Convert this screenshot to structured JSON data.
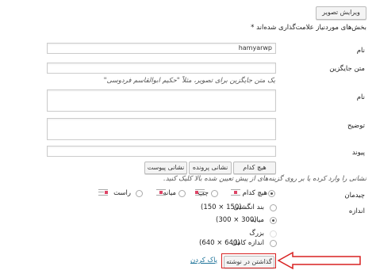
{
  "header": {
    "edit_image_button": "ویرایش تصویر",
    "required_note": "بخش‌های موردنیاز علامت‌گذاری شده‌اند *"
  },
  "fields": {
    "name": {
      "label": "نام",
      "value": "hamyarwp"
    },
    "alt_text": {
      "label": "متن جایگزین",
      "value": "",
      "hint": "یک متن جایگزین برای تصویر، مثلاً \"حکیم ابوالقاسم فردوسی\""
    },
    "caption": {
      "label": "نام",
      "value": ""
    },
    "description": {
      "label": "توضیح",
      "value": ""
    },
    "link": {
      "label": "پیوند",
      "value": "",
      "buttons": {
        "none": "هیچ کدام",
        "file": "نشانی پرونده",
        "post": "نشانی پیوست"
      },
      "hint": "نشانی را وارد کرده یا بر روی گزینه‌های از پیش تعیین شده بالا کلیک کنید."
    }
  },
  "alignment": {
    "label": "چیدمان",
    "options": [
      {
        "name": "none",
        "label": "هیچ کدام",
        "selected": true
      },
      {
        "name": "left",
        "label": "چپ",
        "selected": false
      },
      {
        "name": "center",
        "label": "میانه",
        "selected": false
      },
      {
        "name": "right",
        "label": "راست",
        "selected": false
      }
    ]
  },
  "size": {
    "label": "اندازه",
    "options": [
      {
        "name": "thumbnail",
        "label": "بند انگشتی",
        "dims": "(150 × 150)",
        "selected": false
      },
      {
        "name": "medium",
        "label": "میانه",
        "dims": "(300 × 300)",
        "selected": true
      },
      {
        "name": "large",
        "label": "بزرگ",
        "dims": "",
        "selected": false
      },
      {
        "name": "full",
        "label": "اندازه کامل",
        "dims": "(640 × 640)",
        "selected": false
      }
    ]
  },
  "footer": {
    "insert_button": "گذاشتن در نوشته",
    "clear_link": "پاک کردن"
  },
  "colors": {
    "annotation_red": "#d82020"
  }
}
